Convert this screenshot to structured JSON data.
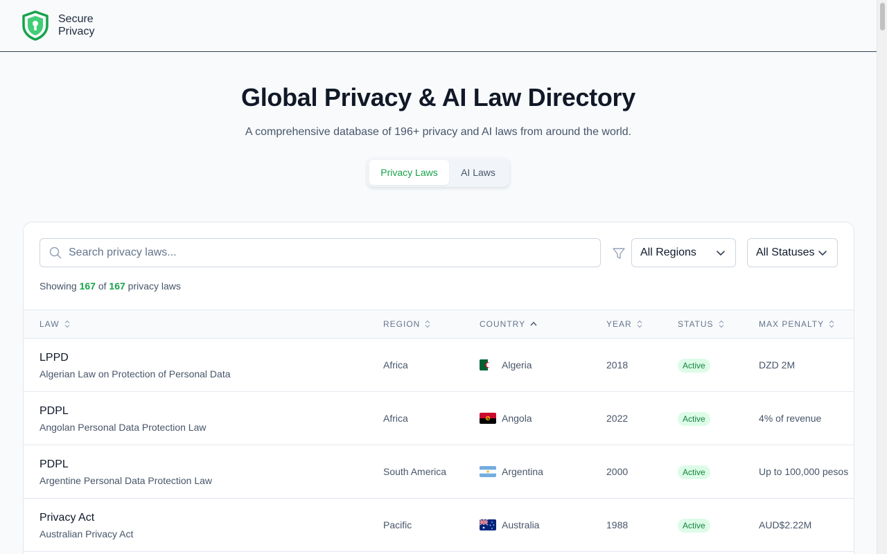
{
  "header": {
    "logo_line1": "Secure",
    "logo_line2": "Privacy"
  },
  "hero": {
    "title": "Global Privacy & AI Law Directory",
    "subtitle": "A comprehensive database of 196+ privacy and AI laws from around the world."
  },
  "tabs": [
    {
      "label": "Privacy Laws",
      "active": true
    },
    {
      "label": "AI Laws",
      "active": false
    }
  ],
  "filters": {
    "search_placeholder": "Search privacy laws...",
    "region_selected": "All Regions",
    "status_selected": "All Statuses"
  },
  "summary": {
    "prefix": "Showing",
    "shown": "167",
    "of": "of",
    "total": "167",
    "suffix": "privacy laws"
  },
  "table": {
    "columns": [
      "LAW",
      "REGION",
      "COUNTRY",
      "YEAR",
      "STATUS",
      "MAX PENALTY"
    ],
    "sorted_column": "COUNTRY",
    "sort_direction": "ascending",
    "rows": [
      {
        "law": "LPPD",
        "law_full": "Algerian Law on Protection of Personal Data",
        "region": "Africa",
        "country": "Algeria",
        "flag": "algeria",
        "year": "2018",
        "status": "Active",
        "penalty": "DZD 2M"
      },
      {
        "law": "PDPL",
        "law_full": "Angolan Personal Data Protection Law",
        "region": "Africa",
        "country": "Angola",
        "flag": "angola",
        "year": "2022",
        "status": "Active",
        "penalty": "4% of revenue"
      },
      {
        "law": "PDPL",
        "law_full": "Argentine Personal Data Protection Law",
        "region": "South America",
        "country": "Argentina",
        "flag": "argentina",
        "year": "2000",
        "status": "Active",
        "penalty": "Up to 100,000 pesos"
      },
      {
        "law": "Privacy Act",
        "law_full": "Australian Privacy Act",
        "region": "Pacific",
        "country": "Australia",
        "flag": "australia",
        "year": "1988",
        "status": "Active",
        "penalty": "AUD$2.22M"
      }
    ]
  },
  "colors": {
    "accent": "#16a34a",
    "badge_bg": "#dcfce7",
    "badge_text": "#15803d"
  },
  "icons": [
    "shield-logo-icon",
    "search-icon",
    "filter-icon",
    "chevron-down-icon",
    "sort-icon",
    "sort-ascending-icon"
  ]
}
